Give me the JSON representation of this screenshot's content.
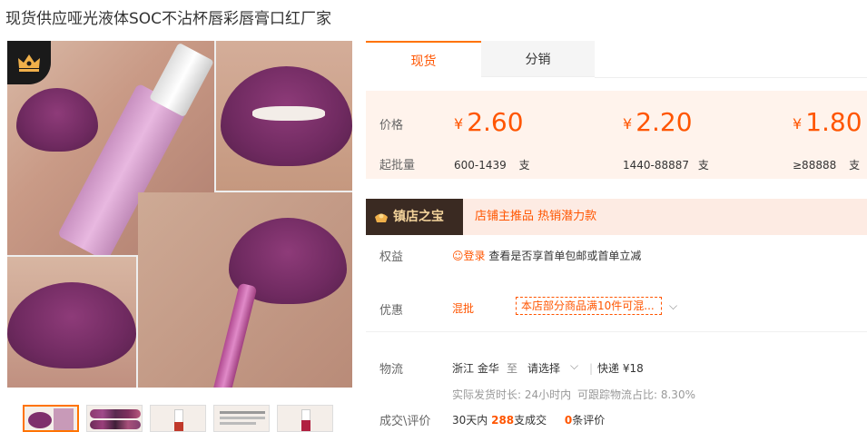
{
  "product": {
    "title": "现货供应哑光液体SOC不沾杯唇彩唇膏口红厂家"
  },
  "tabs": [
    {
      "label": "现货"
    },
    {
      "label": "分销"
    }
  ],
  "pricing": {
    "price_label": "价格",
    "moq_label": "起批量",
    "currency": "¥",
    "tiers": [
      {
        "price": "2.60",
        "range": "600-1439",
        "unit": "支"
      },
      {
        "price": "2.20",
        "range": "1440-88887",
        "unit": "支"
      },
      {
        "price": "1.80",
        "range": "≥88888",
        "unit": "支"
      }
    ]
  },
  "shop": {
    "badge": "镇店之宝",
    "tags": "店铺主推品  热销潜力款"
  },
  "rights": {
    "label": "权益",
    "login": "登录",
    "text": "查看是否享首单包邮或首单立减"
  },
  "discount": {
    "label": "优惠",
    "type": "混批",
    "detail": "本店部分商品满10件可混..."
  },
  "logistics": {
    "label": "物流",
    "origin": "浙江 金华",
    "to": "至",
    "dest": "请选择",
    "method": "快递 ¥18",
    "ship_time": "实际发货时长: 24小时内",
    "track_rate": "可跟踪物流占比: 8.30%"
  },
  "sales": {
    "label": "成交\\评价",
    "period": "30天内",
    "count": "288",
    "count_unit": "支成交",
    "reviews": "0",
    "reviews_unit": "条评价"
  },
  "colors": {
    "accent": "#ff5500",
    "price_bg": "#fff3ec",
    "shop_bg": "#fdebe3"
  }
}
